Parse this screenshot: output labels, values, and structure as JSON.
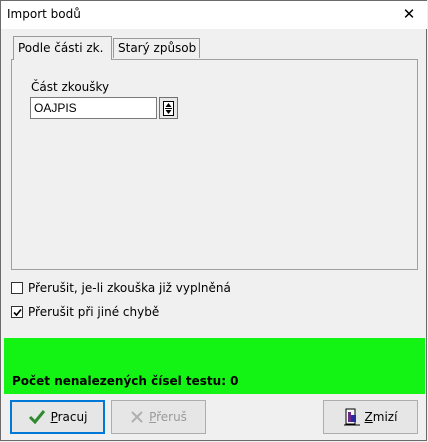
{
  "window": {
    "title": "Import bodů",
    "close_icon": "close-icon"
  },
  "tabs": [
    {
      "label": "Podle části zk.",
      "active": true
    },
    {
      "label": "Starý způsob",
      "active": false
    }
  ],
  "form": {
    "field_label": "Část zkoušky",
    "field_value": "OAJPIS",
    "picker_icon": "picker-icon"
  },
  "options": [
    {
      "label": "Přerušit, je-li zkouška již vyplněná",
      "checked": false
    },
    {
      "label": "Přerušit při jiné chybě",
      "checked": true
    }
  ],
  "status": {
    "text": "Počet nenalezených čísel testu: 0",
    "color": "#14f414"
  },
  "buttons": {
    "run": {
      "label_mnemonic": "P",
      "label_rest": "racuj",
      "icon": "checkmark-icon"
    },
    "stop": {
      "label_mnemonic": "P",
      "label_rest": "řeruš",
      "icon": "cross-icon",
      "enabled": false
    },
    "close": {
      "label_mnemonic": "Z",
      "label_rest": "mizí",
      "icon": "exit-door-icon"
    }
  }
}
